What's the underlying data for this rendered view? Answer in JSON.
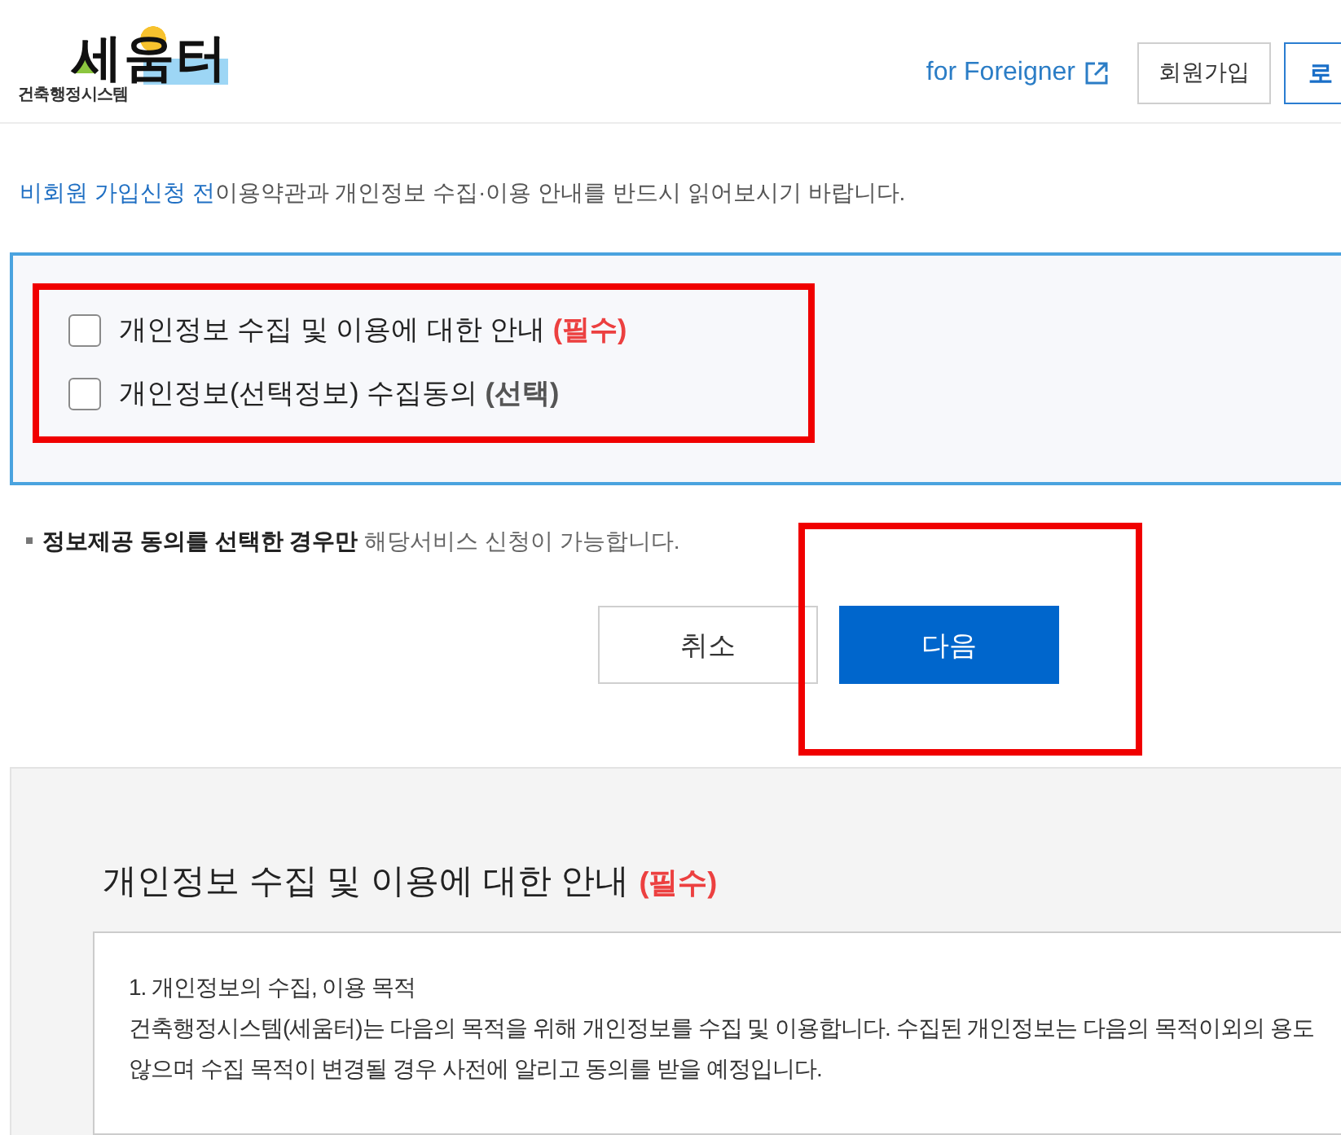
{
  "header": {
    "logo": {
      "caption": "건축행정시스템",
      "wordmark": "세움터"
    },
    "foreigner_link": "for Foreigner",
    "buttons": [
      {
        "label": "회원가입",
        "kind": "outline"
      },
      {
        "label": "로",
        "kind": "primary"
      }
    ]
  },
  "notice": {
    "highlight": "비회원 가입신청 전",
    "text": "이용약관과 개인정보 수집·이용 안내를 반드시 읽어보시기 바랍니다."
  },
  "consent": {
    "highlighted": true,
    "items": [
      {
        "label": "개인정보 수집 및 이용에 대한 안내",
        "tag": "(필수)",
        "kind": "required",
        "checked": false
      },
      {
        "label": "개인정보(선택정보) 수집동의",
        "tag": "(선택)",
        "kind": "optional",
        "checked": false
      }
    ]
  },
  "note": "**정보제공 동의를 선택한 경우만** 해당서비스 신청이 가능합니다.",
  "actions": [
    {
      "label": "취소",
      "kind": "secondary",
      "highlighted": false
    },
    {
      "label": "다음",
      "kind": "primary",
      "highlighted": true
    }
  ],
  "terms": {
    "title": "개인정보 수집 및 이용에 대한 안내",
    "tag": "(필수)",
    "lines": [
      "1. 개인정보의 수집, 이용 목적",
      "건축행정시스템(세움터)는 다음의 목적을 위해 개인정보를 수집 및 이용합니다. 수집된 개인정보는 다음의 목적이외의 용도",
      "않으며 수집 목적이 변경될 경우 사전에 알리고 동의를 받을 예정입니다."
    ]
  }
}
